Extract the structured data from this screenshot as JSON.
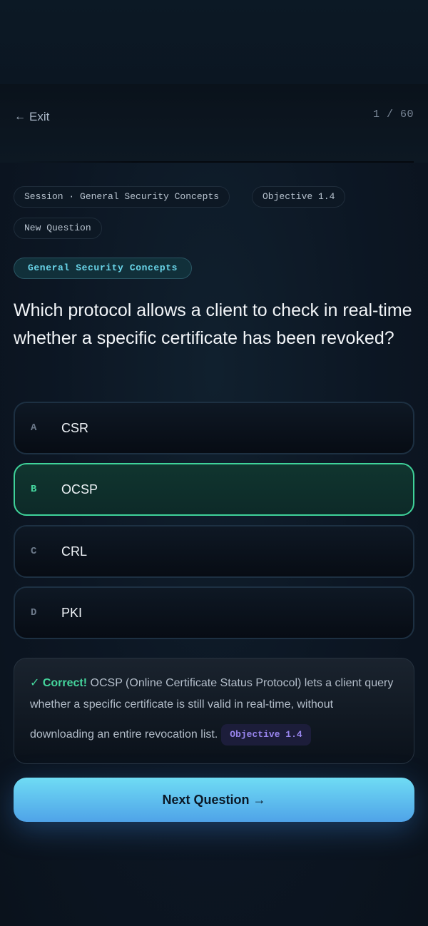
{
  "header": {
    "exit_arrow": "←",
    "exit_label": "Exit",
    "progress": "1 / 60"
  },
  "chips": {
    "session": "Session · General Security Concepts",
    "objective": "Objective 1.4",
    "status": "New Question"
  },
  "topic": "General Security Concepts",
  "question": "Which protocol allows a client to check in real-time whether a specific certificate has been revoked?",
  "options": [
    {
      "letter": "A",
      "text": "CSR"
    },
    {
      "letter": "B",
      "text": "OCSP",
      "state": "correct"
    },
    {
      "letter": "C",
      "text": "CRL"
    },
    {
      "letter": "D",
      "text": "PKI"
    }
  ],
  "feedback": {
    "label": "✓ Correct!",
    "text_part1": " OCSP (Online Certificate Status Protocol) lets a client query whether a specific certificate is still valid in real-time, without",
    "text_part2": "downloading an entire revocation list.",
    "badge": "Objective 1.4"
  },
  "next_button": "Next Question →",
  "colors": {
    "correct": "#3fd39a",
    "accent": "#6ad6ea",
    "badge": "#9a86f0",
    "button_start": "#6fdcf4",
    "button_end": "#4fa3e8"
  }
}
